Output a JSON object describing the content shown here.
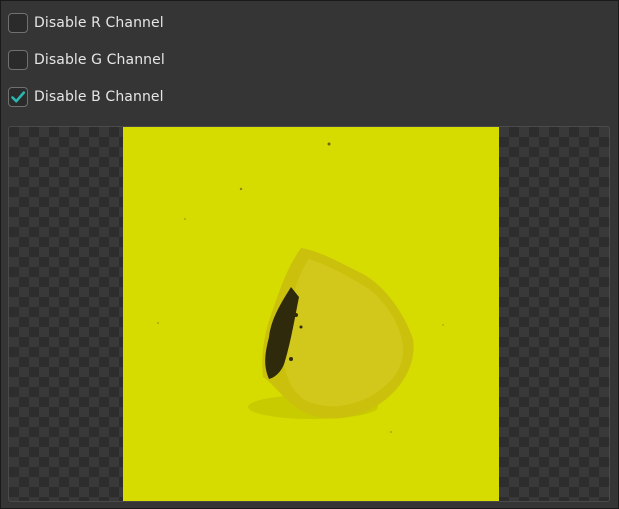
{
  "channels": {
    "r": {
      "label": "Disable R Channel",
      "checked": false
    },
    "g": {
      "label": "Disable G Channel",
      "checked": false
    },
    "b": {
      "label": "Disable B Channel",
      "checked": true
    }
  },
  "colors": {
    "check_accent": "#2ab7b0",
    "image_background": "#d6db00",
    "object": "#c9c10d"
  },
  "image": {
    "subject": "object-on-yellow-background"
  }
}
